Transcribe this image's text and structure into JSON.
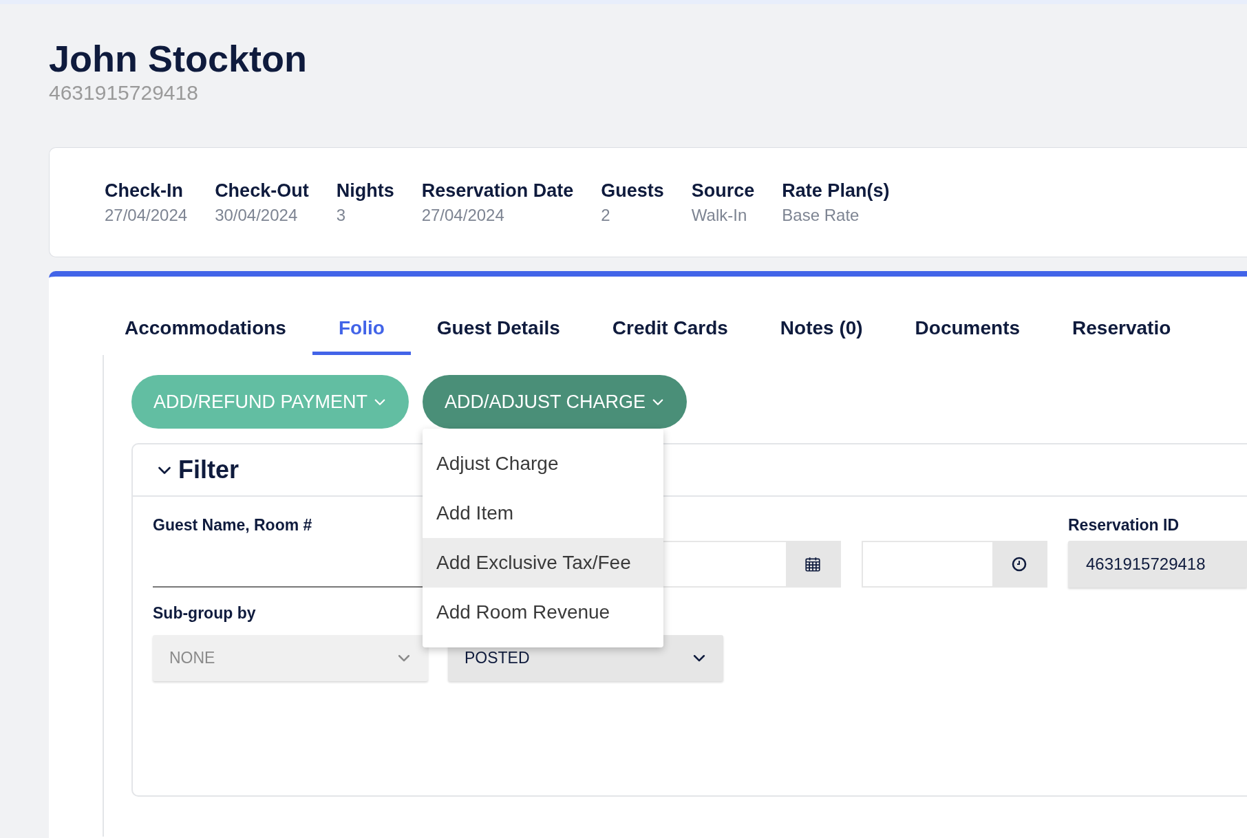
{
  "header": {
    "name": "John Stockton",
    "id": "4631915729418"
  },
  "summary": [
    {
      "label": "Check-In",
      "value": "27/04/2024"
    },
    {
      "label": "Check-Out",
      "value": "30/04/2024"
    },
    {
      "label": "Nights",
      "value": "3"
    },
    {
      "label": "Reservation Date",
      "value": "27/04/2024"
    },
    {
      "label": "Guests",
      "value": "2"
    },
    {
      "label": "Source",
      "value": "Walk-In"
    },
    {
      "label": "Rate Plan(s)",
      "value": "Base Rate"
    }
  ],
  "tabs": [
    {
      "label": "Accommodations",
      "selected": false
    },
    {
      "label": "Folio",
      "selected": true
    },
    {
      "label": "Guest Details",
      "selected": false
    },
    {
      "label": "Credit Cards",
      "selected": false
    },
    {
      "label": "Notes (0)",
      "selected": false
    },
    {
      "label": "Documents",
      "selected": false
    },
    {
      "label": "Reservatio",
      "selected": false
    }
  ],
  "actions": [
    {
      "label": "ADD/REFUND PAYMENT",
      "expanded": false
    },
    {
      "label": "ADD/ADJUST CHARGE",
      "expanded": true
    }
  ],
  "charge_menu": [
    {
      "label": "Adjust Charge",
      "selected": false
    },
    {
      "label": "Add Item",
      "selected": false
    },
    {
      "label": "Add Exclusive Tax/Fee",
      "selected": true
    },
    {
      "label": "Add Room Revenue",
      "selected": false
    }
  ],
  "filter": {
    "title": "Filter",
    "expanded": true,
    "search": {
      "label": "Guest Name, Room #"
    },
    "pickers": [
      {
        "kind": "date"
      },
      {
        "kind": "time"
      }
    ],
    "reservation_id": {
      "label": "Reservation ID",
      "value": "4631915729418"
    },
    "subgroup": {
      "label": "Sub-group by",
      "value": "NONE",
      "disabled": true
    },
    "status": {
      "value": "POSTED",
      "disabled": false
    }
  }
}
